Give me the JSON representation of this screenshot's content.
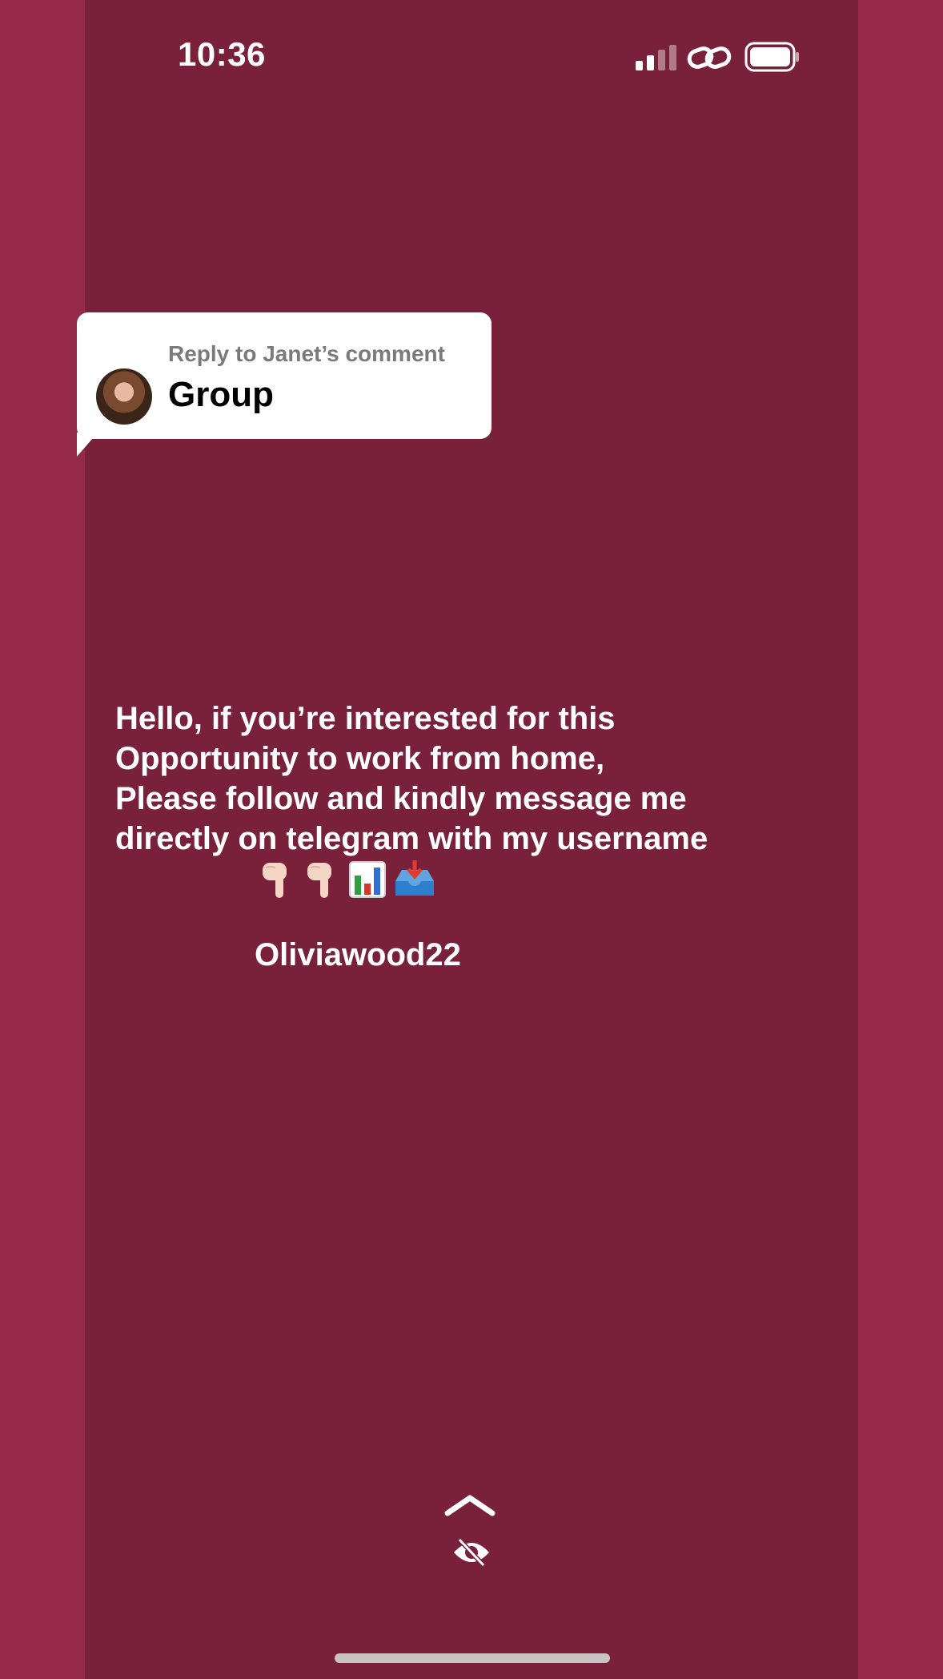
{
  "status_bar": {
    "time": "10:36",
    "icons": [
      "cellular-signal-icon",
      "link-icon",
      "battery-icon"
    ]
  },
  "reply_sticker": {
    "label": "Reply to Janet’s comment",
    "title": "Group",
    "avatar_icon": "avatar"
  },
  "story": {
    "lines": [
      "Hello, if you’re interested for this",
      "Opportunity to work from home,",
      "Please follow and kindly message me",
      "directly on telegram with my username"
    ],
    "emojis": [
      "pointing-down-icon",
      "pointing-down-icon",
      "bar-chart-icon",
      "inbox-tray-icon"
    ],
    "username": "Oliviawood22"
  },
  "controls": {
    "icons": [
      "chevron-up-icon",
      "eye-slash-icon"
    ]
  },
  "colors": {
    "frame": "#96294a",
    "background": "#79213a",
    "text": "#ffffff"
  }
}
